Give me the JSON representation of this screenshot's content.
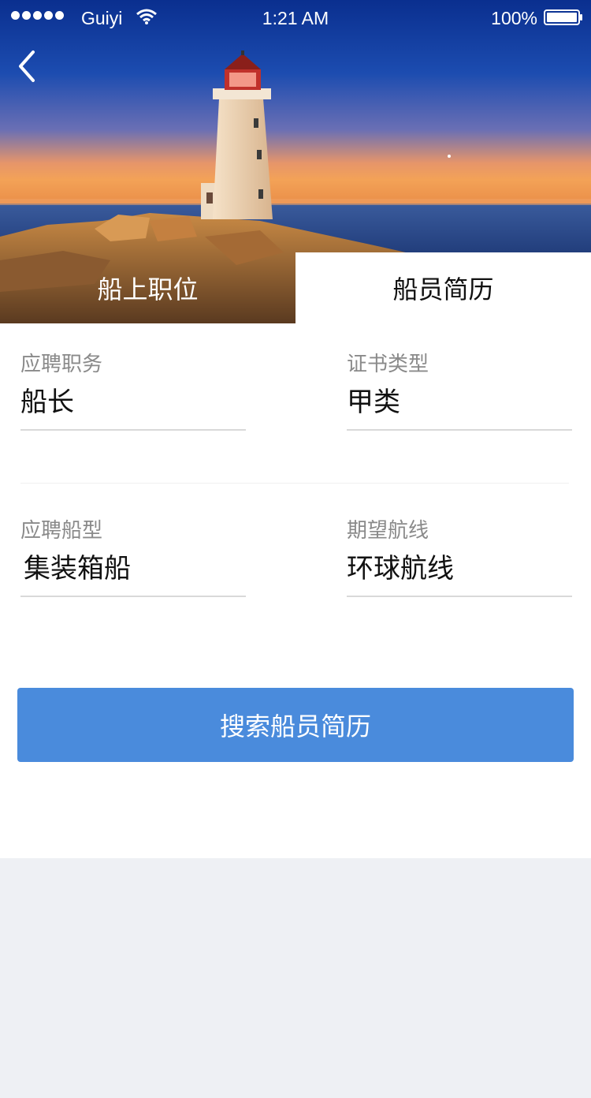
{
  "status_bar": {
    "carrier": "Guiyi",
    "time": "1:21 AM",
    "battery": "100%"
  },
  "tabs": [
    {
      "label": "船上职位",
      "active": false
    },
    {
      "label": "船员简历",
      "active": true
    }
  ],
  "form": {
    "position": {
      "label": "应聘职务",
      "value": "船长"
    },
    "certificate": {
      "label": "证书类型",
      "value": "甲类"
    },
    "ship_type": {
      "label": "应聘船型",
      "value": "集装箱船"
    },
    "route": {
      "label": "期望航线",
      "value": "环球航线"
    }
  },
  "search_button": {
    "label": "搜索船员简历"
  },
  "colors": {
    "accent": "#4a8bdc",
    "page_bg": "#eef0f4"
  },
  "icons": [
    "back-icon",
    "wifi-icon",
    "battery-icon"
  ]
}
